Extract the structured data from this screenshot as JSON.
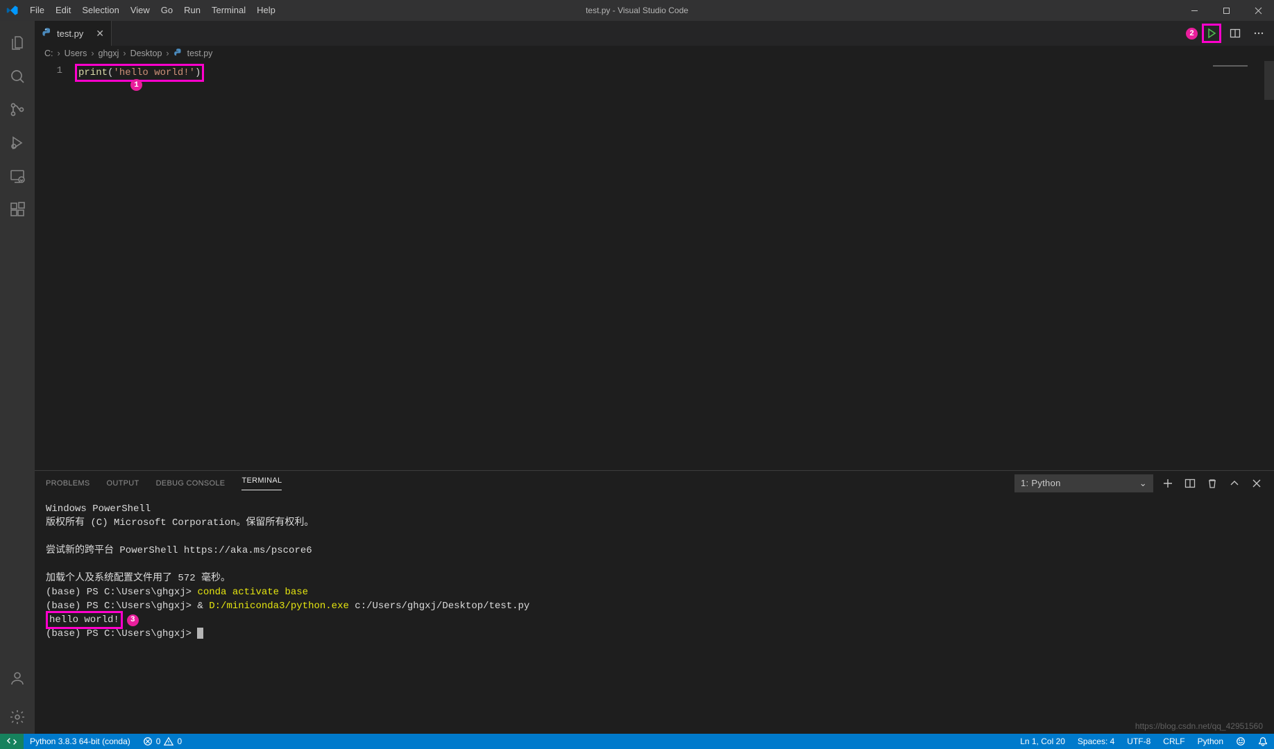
{
  "titlebar": {
    "menus": [
      "File",
      "Edit",
      "Selection",
      "View",
      "Go",
      "Run",
      "Terminal",
      "Help"
    ],
    "title": "test.py - Visual Studio Code"
  },
  "tabs": {
    "active": {
      "label": "test.py"
    }
  },
  "annotations": {
    "badge1": "1",
    "badge2": "2",
    "badge3": "3"
  },
  "breadcrumbs": {
    "seg0": "C:",
    "seg1": "Users",
    "seg2": "ghgxj",
    "seg3": "Desktop",
    "seg4": "test.py"
  },
  "editor": {
    "line_no": "1",
    "token_fn": "print",
    "token_lpar": "(",
    "token_str": "'hello world!'",
    "token_rpar": ")"
  },
  "panel": {
    "tabs": {
      "problems": "PROBLEMS",
      "output": "OUTPUT",
      "debug": "DEBUG CONSOLE",
      "terminal": "TERMINAL"
    },
    "selector": "1: Python"
  },
  "terminal": {
    "l1": "Windows PowerShell",
    "l2": "版权所有 (C) Microsoft Corporation。保留所有权利。",
    "l3": "尝试新的跨平台 PowerShell https://aka.ms/pscore6",
    "l4": "加载个人及系统配置文件用了 572 毫秒。",
    "p1_prefix": "(base) PS C:\\Users\\ghgxj> ",
    "p1_cmd": "conda activate base",
    "p2_prefix": "(base) PS C:\\Users\\ghgxj> & ",
    "p2_cmd": "D:/miniconda3/python.exe",
    "p2_suffix": " c:/Users/ghgxj/Desktop/test.py",
    "out": "hello world!",
    "p3_prefix": "(base) PS C:\\Users\\ghgxj> "
  },
  "status": {
    "python": "Python 3.8.3 64-bit (conda)",
    "errors": "0",
    "warnings": "0",
    "ln_col": "Ln 1, Col 20",
    "spaces": "Spaces: 4",
    "encoding": "UTF-8",
    "eol": "CRLF",
    "lang": "Python"
  },
  "watermark": "https://blog.csdn.net/qq_42951560"
}
